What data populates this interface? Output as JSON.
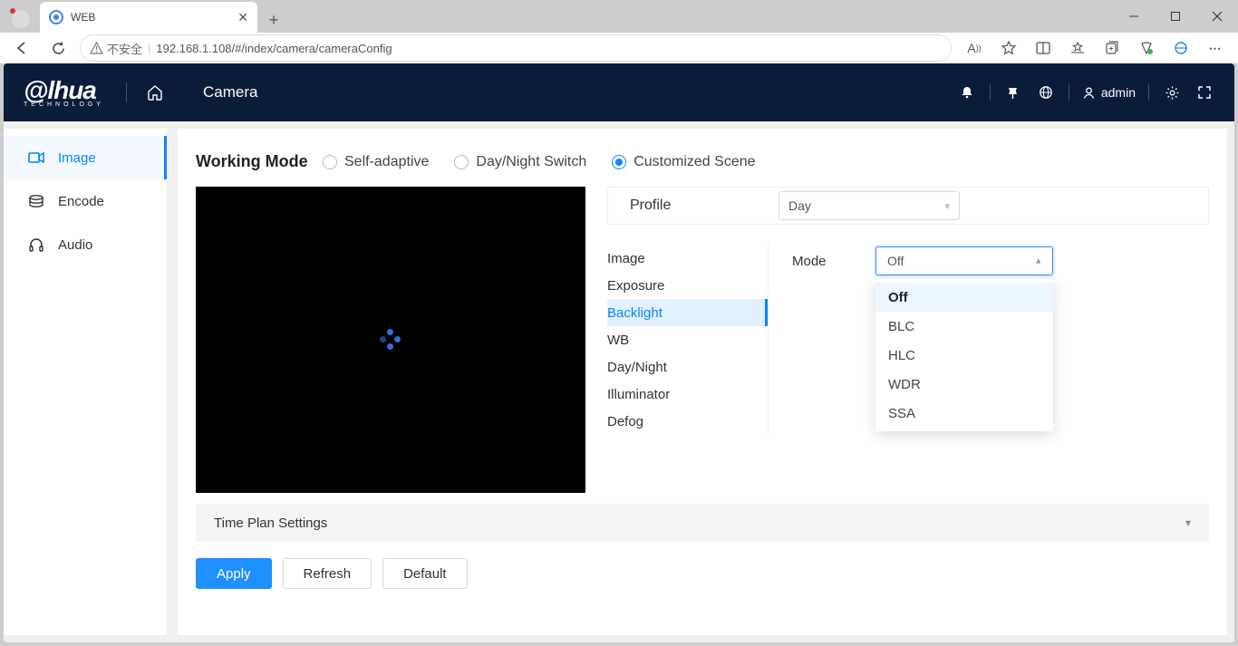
{
  "browser": {
    "tab_title": "WEB",
    "security_text": "不安全",
    "url": "192.168.1.108/#/index/camera/cameraConfig"
  },
  "header": {
    "logo_main": "alhua",
    "logo_sub": "TECHNOLOGY",
    "title": "Camera",
    "user": "admin"
  },
  "sidebar": {
    "items": [
      {
        "label": "Image"
      },
      {
        "label": "Encode"
      },
      {
        "label": "Audio"
      }
    ]
  },
  "working_mode": {
    "label": "Working Mode",
    "options": [
      "Self-adaptive",
      "Day/Night Switch",
      "Customized Scene"
    ],
    "selected_index": 2
  },
  "profile": {
    "label": "Profile",
    "value": "Day"
  },
  "vtabs": [
    "Image",
    "Exposure",
    "Backlight",
    "WB",
    "Day/Night",
    "Illuminator",
    "Defog"
  ],
  "vtab_selected_index": 2,
  "mode": {
    "label": "Mode",
    "value": "Off",
    "options": [
      "Off",
      "BLC",
      "HLC",
      "WDR",
      "SSA"
    ],
    "selected_index": 0
  },
  "collapse": {
    "label": "Time Plan Settings"
  },
  "buttons": {
    "apply": "Apply",
    "refresh": "Refresh",
    "default": "Default"
  }
}
